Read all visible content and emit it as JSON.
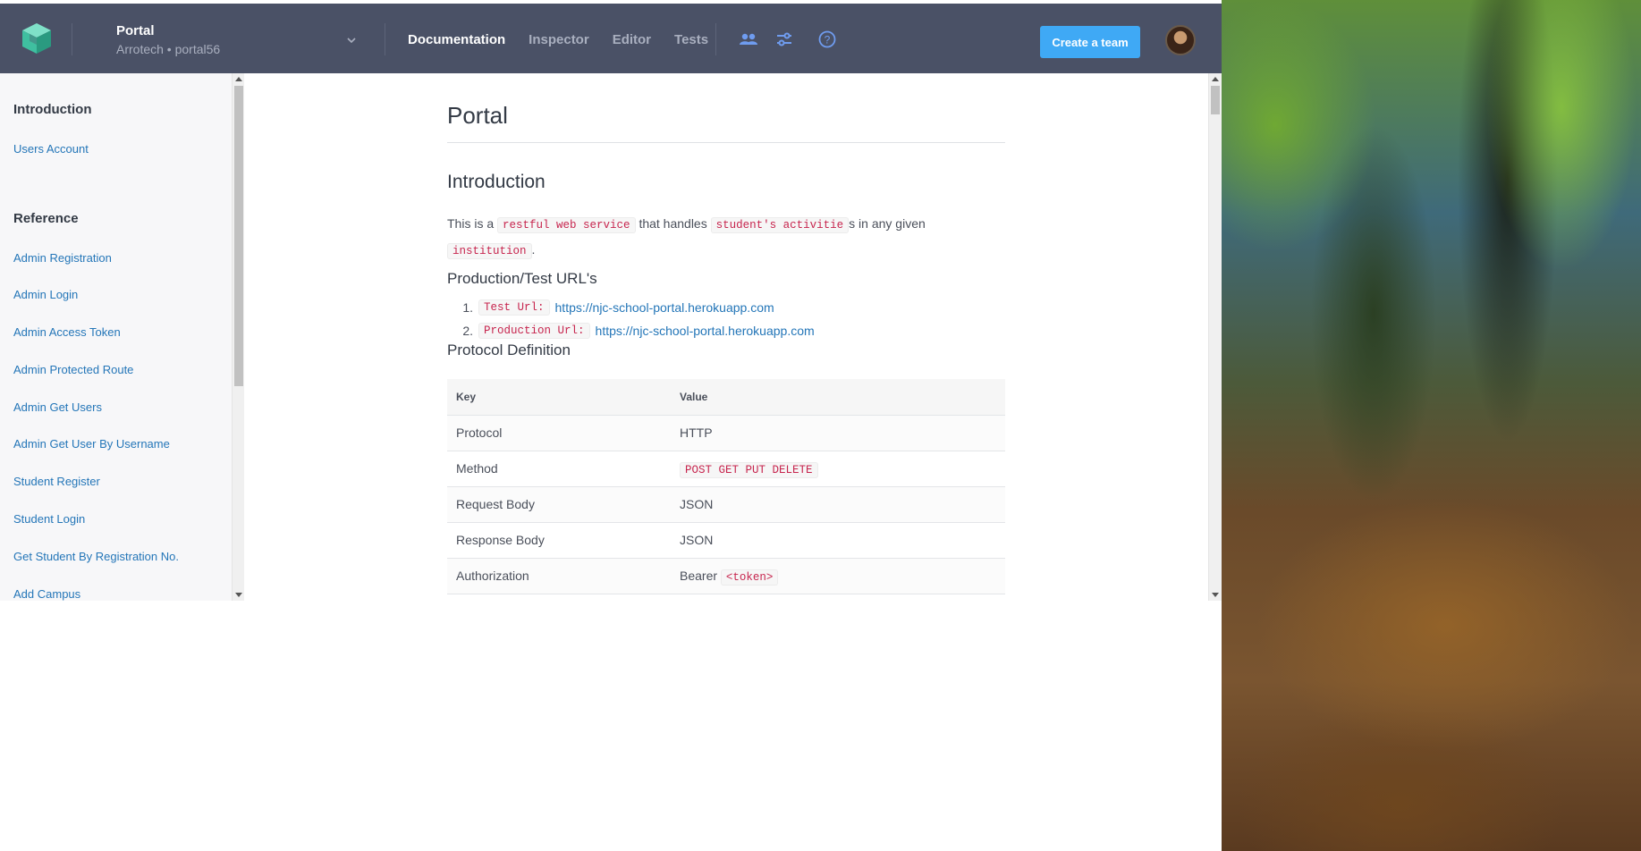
{
  "header": {
    "project_name": "Portal",
    "project_sub": "Arrotech • portal56",
    "tabs": [
      {
        "label": "Documentation",
        "active": true
      },
      {
        "label": "Inspector",
        "active": false
      },
      {
        "label": "Editor",
        "active": false
      },
      {
        "label": "Tests",
        "active": false
      }
    ],
    "icons": [
      "team-icon",
      "settings-sliders-icon",
      "help-icon"
    ],
    "create_team_label": "Create a team",
    "accent_color": "#3fa9f5",
    "bar_color": "#4a5166"
  },
  "sidebar": {
    "sections": [
      {
        "heading": "Introduction",
        "items": [
          "Users Account"
        ]
      },
      {
        "heading": "Reference",
        "items": [
          "Admin Registration",
          "Admin Login",
          "Admin Access Token",
          "Admin Protected Route",
          "Admin Get Users",
          "Admin Get User By Username",
          "Student Register",
          "Student Login",
          "Get Student By Registration No.",
          "Add Campus"
        ]
      }
    ]
  },
  "doc": {
    "title": "Portal",
    "intro_heading": "Introduction",
    "intro": {
      "t1": "This is a",
      "c1": "restful web service",
      "t2": "that handles",
      "c2": "student's activitie",
      "t3": "s in any given",
      "c3": "institution",
      "t4": "."
    },
    "urls_heading": "Production/Test URL's",
    "urls": [
      {
        "num": "1.",
        "label": "Test Url:",
        "url": "https://njc-school-portal.herokuapp.com"
      },
      {
        "num": "2.",
        "label": "Production Url:",
        "url": "https://njc-school-portal.herokuapp.com"
      }
    ],
    "protocol_heading": "Protocol Definition",
    "table": {
      "headers": [
        "Key",
        "Value"
      ],
      "rows": [
        {
          "key": "Protocol",
          "value": "HTTP",
          "code": ""
        },
        {
          "key": "Method",
          "value": "",
          "code": "POST GET PUT DELETE"
        },
        {
          "key": "Request Body",
          "value": "JSON",
          "code": ""
        },
        {
          "key": "Response Body",
          "value": "JSON",
          "code": ""
        },
        {
          "key": "Authorization",
          "value": "Bearer",
          "code": "<token>"
        }
      ]
    }
  }
}
